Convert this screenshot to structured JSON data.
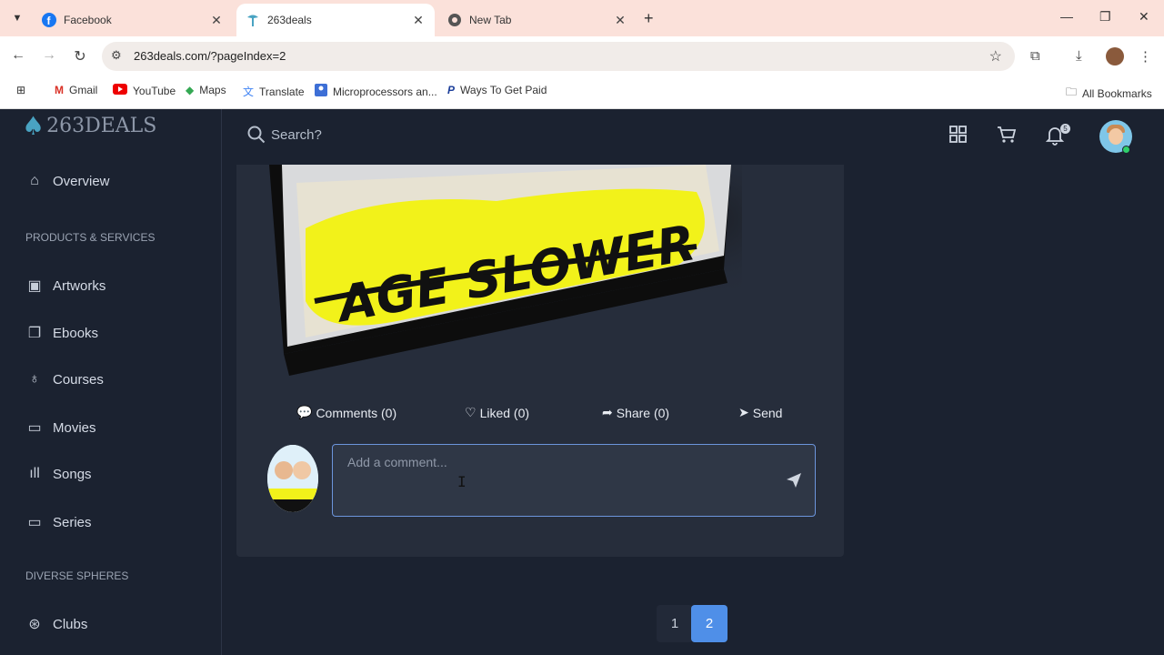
{
  "browser": {
    "tabs": [
      {
        "title": "Facebook",
        "icon": "facebook-icon"
      },
      {
        "title": "263deals",
        "icon": "263deals-icon"
      },
      {
        "title": "New Tab",
        "icon": "chrome-icon"
      }
    ],
    "url": "263deals.com/?pageIndex=2",
    "bookmarks": [
      {
        "label": "Gmail",
        "icon": "gmail-icon"
      },
      {
        "label": "YouTube",
        "icon": "youtube-icon"
      },
      {
        "label": "Maps",
        "icon": "maps-icon"
      },
      {
        "label": "Translate",
        "icon": "translate-icon"
      },
      {
        "label": "Microprocessors an...",
        "icon": "doc-icon"
      },
      {
        "label": "Ways To Get Paid",
        "icon": "paypal-icon"
      }
    ],
    "all_bookmarks": "All Bookmarks"
  },
  "site": {
    "logo_text": "263DEALS",
    "search_placeholder": "Search?",
    "notification_count": "5"
  },
  "sidebar": {
    "overview": "Overview",
    "section_products": "PRODUCTS & SERVICES",
    "items": [
      "Artworks",
      "Ebooks",
      "Courses",
      "Movies",
      "Songs",
      "Series"
    ],
    "section_diverse": "DIVERSE SPHERES",
    "clubs": "Clubs"
  },
  "post": {
    "product_title": "AGE SLOWER",
    "comments": "Comments (0)",
    "liked": "Liked (0)",
    "share": "Share (0)",
    "send": "Send",
    "comment_placeholder": "Add a comment..."
  },
  "pagination": {
    "pages": [
      "1",
      "2"
    ],
    "current": "2"
  },
  "colors": {
    "background": "#1b2230",
    "card": "#262d3b",
    "accent": "#4f8fe8",
    "product_yellow": "#f2f21a"
  }
}
